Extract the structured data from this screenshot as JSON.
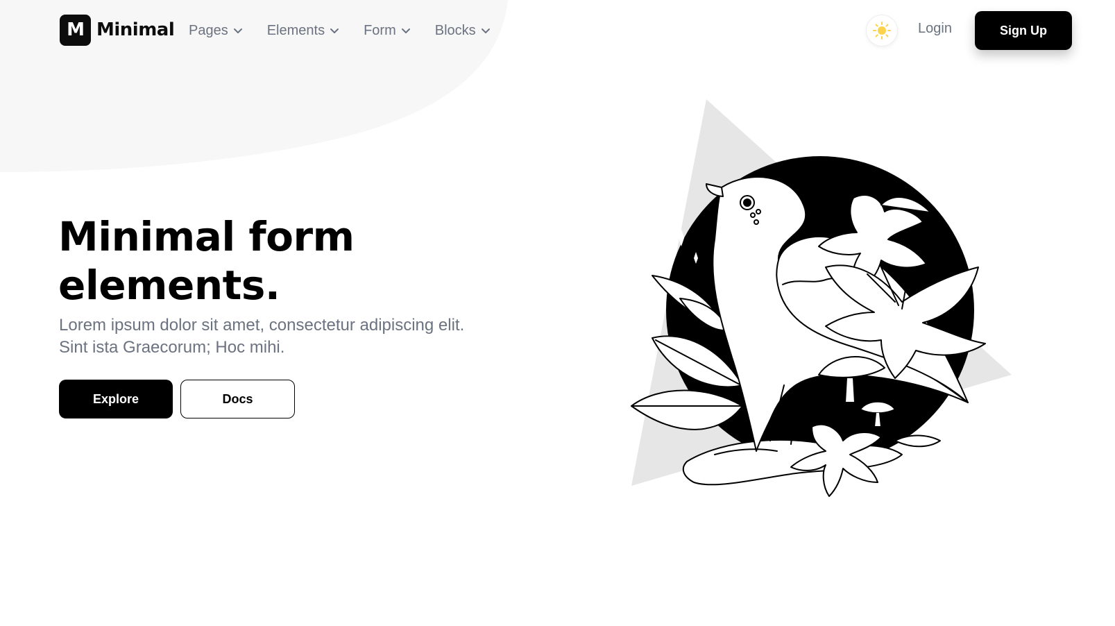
{
  "brand": {
    "mark": "M",
    "name": "Minimal"
  },
  "nav": {
    "items": [
      {
        "label": "Pages",
        "icon": "chevron-down-icon"
      },
      {
        "label": "Elements",
        "icon": "chevron-down-icon"
      },
      {
        "label": "Form",
        "icon": "chevron-down-icon"
      },
      {
        "label": "Blocks",
        "icon": "chevron-down-icon"
      }
    ],
    "theme_icon": "sun-icon",
    "login_label": "Login",
    "signup_label": "Sign Up"
  },
  "hero": {
    "title_line1": "Minimal form",
    "title_line2": "elements.",
    "subtitle": "Lorem ipsum dolor sit amet, consectetur adipiscing elit. Sint ista Graecorum; Hoc mihi.",
    "primary_button": "Explore",
    "secondary_button": "Docs"
  },
  "colors": {
    "accent": "#000000",
    "muted_text": "#6b7280",
    "blob": "#f7f7f7",
    "triangle": "#e6e6e6",
    "sun": "#fcd34d"
  }
}
